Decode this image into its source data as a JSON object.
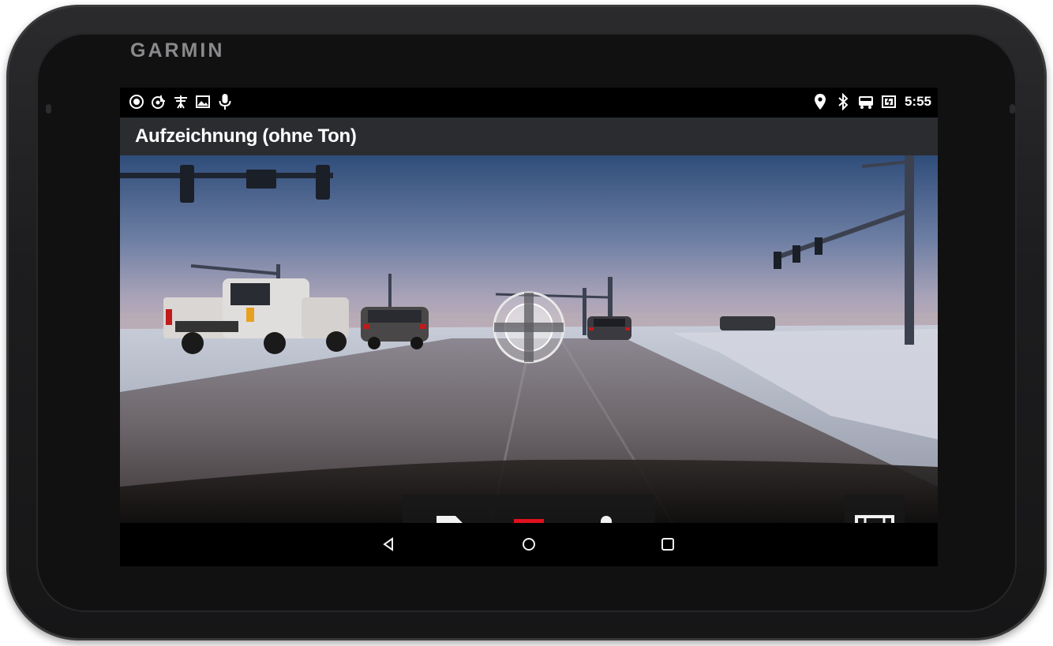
{
  "device": {
    "brand": "GARMIN"
  },
  "status_bar": {
    "left_icons": [
      "record-circle-icon",
      "dashcam-icon",
      "traffic-icon",
      "image-icon",
      "microphone-icon"
    ],
    "right_icons": [
      "location-pin-icon",
      "bluetooth-icon",
      "vehicle-icon",
      "battery-icon"
    ],
    "time": "5:55"
  },
  "header": {
    "title": "Aufzeichnung (ohne Ton)"
  },
  "controls": {
    "items": [
      "sd-card-icon",
      "stop-record-icon",
      "microphone-icon"
    ],
    "record_color": "#e0101e",
    "gallery_icon": "film-strip-icon"
  },
  "navigation": {
    "items": [
      "back-icon",
      "home-icon",
      "recent-apps-icon"
    ]
  }
}
